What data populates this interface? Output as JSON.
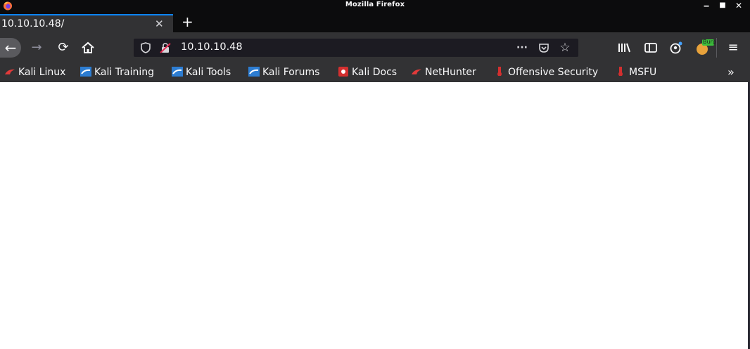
{
  "window": {
    "title": "Mozilla Firefox",
    "controls": [
      "minimize",
      "maximize",
      "close"
    ]
  },
  "tabs": [
    {
      "title": "10.10.10.48/",
      "active": true
    }
  ],
  "toolbar": {
    "url": "10.10.10.48",
    "page_actions_glyph": "···",
    "burp_label": "Burp"
  },
  "bookmarks": [
    {
      "label": "Kali Linux",
      "icon": "kali-dragon-icon",
      "color": "#e23a3a"
    },
    {
      "label": "Kali Training",
      "icon": "kali-training-icon",
      "color": "#2d7dd2"
    },
    {
      "label": "Kali Tools",
      "icon": "kali-tools-icon",
      "color": "#2d7dd2"
    },
    {
      "label": "Kali Forums",
      "icon": "kali-forums-icon",
      "color": "#2d7dd2"
    },
    {
      "label": "Kali Docs",
      "icon": "kali-docs-icon",
      "color": "#d32f2f"
    },
    {
      "label": "NetHunter",
      "icon": "nethunter-icon",
      "color": "#e23a3a"
    },
    {
      "label": "Offensive Security",
      "icon": "offsec-icon",
      "color": "#d32f2f"
    },
    {
      "label": "MSFU",
      "icon": "msfu-icon",
      "color": "#d32f2f"
    }
  ],
  "colors": {
    "titlebar": "#0c0c0d",
    "toolbar": "#323234",
    "accent": "#0a84ff"
  }
}
